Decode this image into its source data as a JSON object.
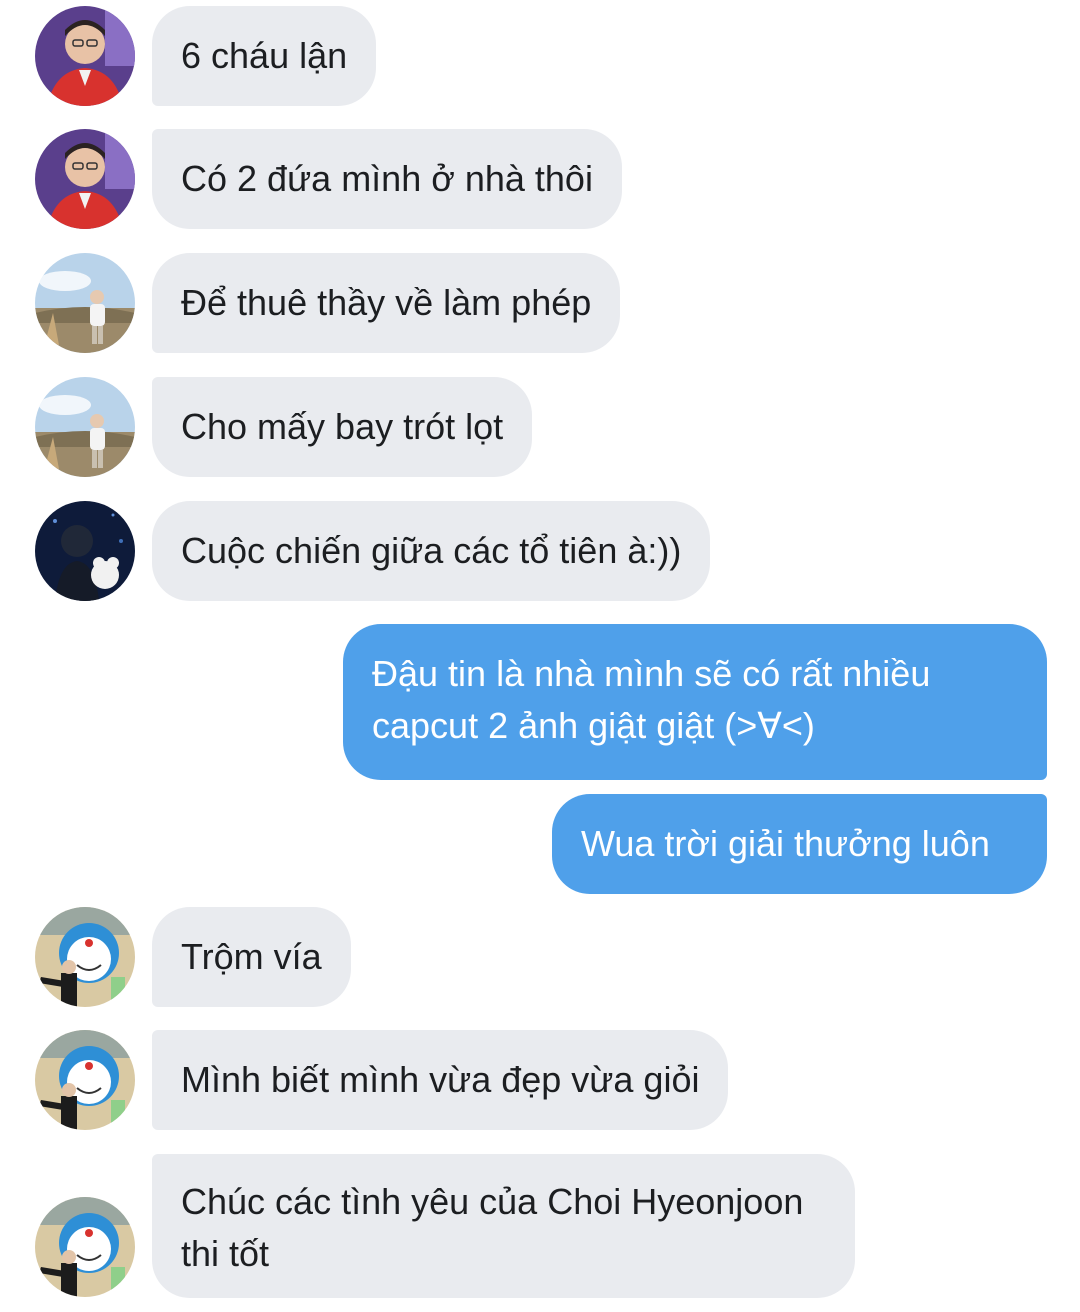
{
  "colors": {
    "incoming_bubble": "#e9ebef",
    "outgoing_bubble": "#4fa0ea",
    "incoming_text": "#1c1e21",
    "outgoing_text": "#ffffff"
  },
  "messages": [
    {
      "direction": "incoming",
      "sender_avatar": "avatar-red-jacket-icon",
      "text": "6 cháu lận"
    },
    {
      "direction": "incoming",
      "sender_avatar": "avatar-red-jacket-icon",
      "text": "Có 2 đứa mình ở nhà thôi"
    },
    {
      "direction": "incoming",
      "sender_avatar": "avatar-field-icon",
      "text": "Để thuê thầy về làm phép"
    },
    {
      "direction": "incoming",
      "sender_avatar": "avatar-field-icon",
      "text": "Cho mấy bay trót lọt"
    },
    {
      "direction": "incoming",
      "sender_avatar": "avatar-night-icon",
      "text": "Cuộc chiến giữa các tổ tiên à:))"
    },
    {
      "direction": "outgoing",
      "text": "Đậu tin là nhà mình sẽ có rất nhiều capcut 2 ảnh giật giật (>∀<)"
    },
    {
      "direction": "outgoing",
      "text": "Wua trời giải thưởng luôn"
    },
    {
      "direction": "incoming",
      "sender_avatar": "avatar-doraemon-icon",
      "text": "Trộm vía"
    },
    {
      "direction": "incoming",
      "sender_avatar": "avatar-doraemon-icon",
      "text": "Mình biết mình vừa đẹp vừa giỏi"
    },
    {
      "direction": "incoming",
      "sender_avatar": "avatar-doraemon-icon",
      "text": "Chúc các tình yêu của Choi Hyeonjoon thi tốt"
    }
  ]
}
